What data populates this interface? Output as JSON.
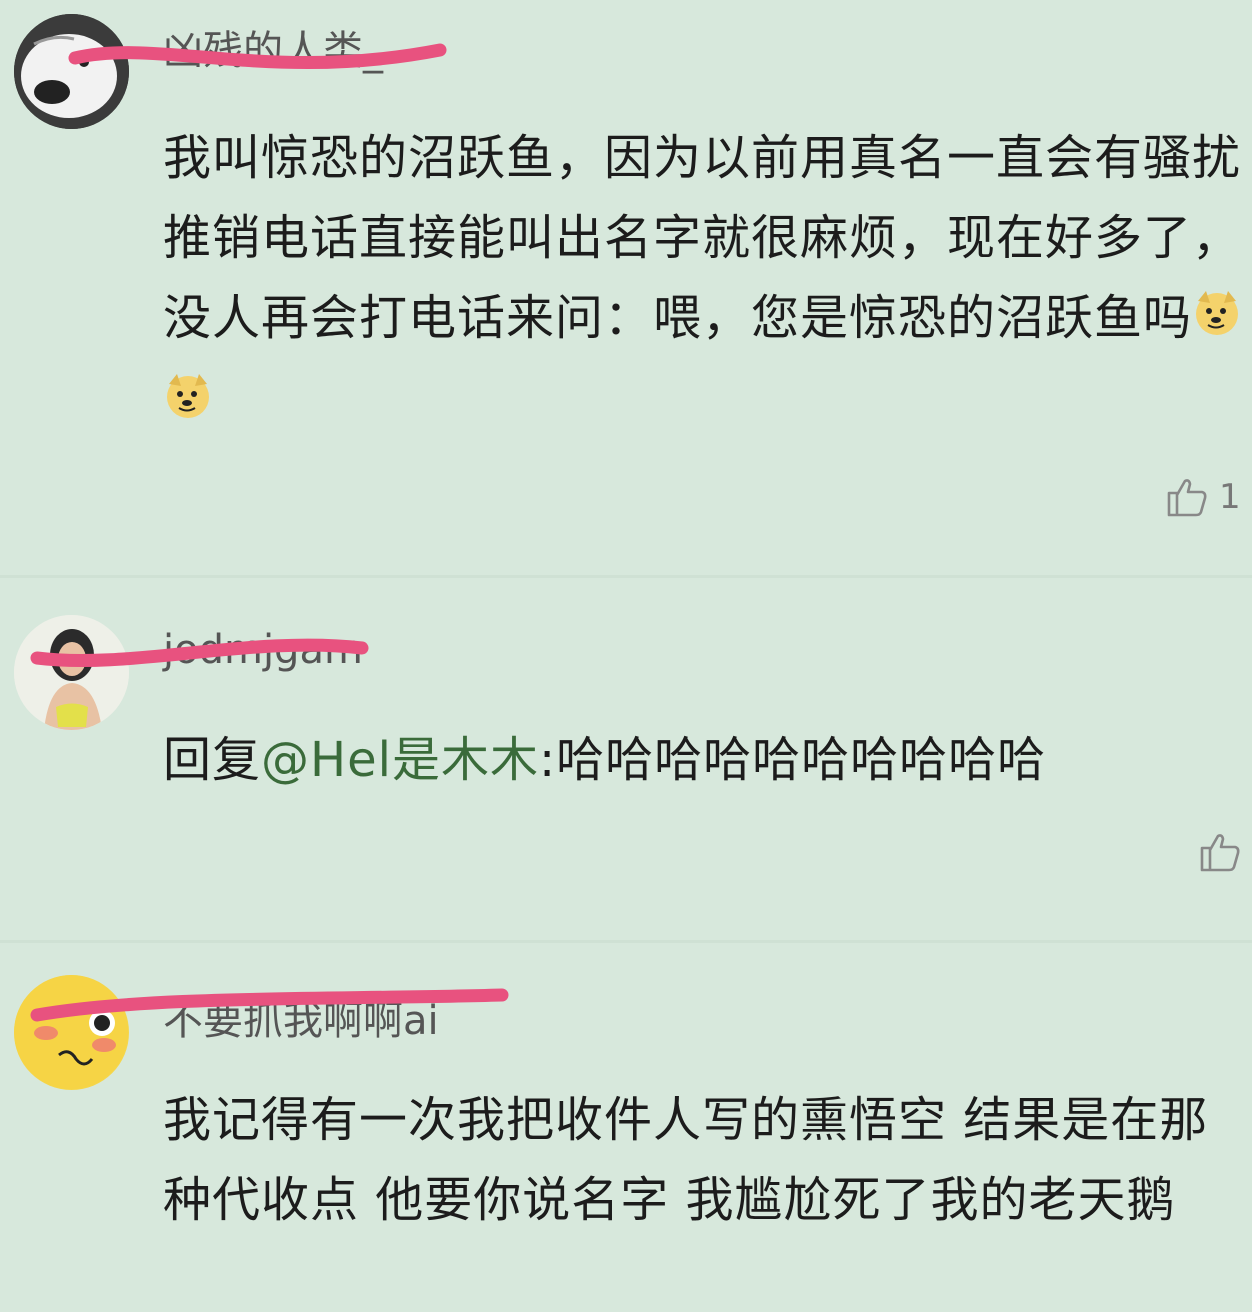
{
  "comments": [
    {
      "username": "凶残的人类_",
      "text": "我叫惊恐的沼跃鱼，因为以前用真名一直会有骚扰推销电话直接能叫出名字就很麻烦，现在好多了，没人再会打电话来问：喂，您是惊恐的沼跃鱼吗",
      "emoji": [
        "doge-emoji",
        "doge-emoji"
      ],
      "likes": "1"
    },
    {
      "username": "jodmjgam",
      "reply_prefix": "回复",
      "mention": "@Hel是木木",
      "reply_text": ":哈哈哈哈哈哈哈哈哈哈",
      "likes": ""
    },
    {
      "username": "不要抓我啊啊ai",
      "text": "我记得有一次我把收件人写的熏悟空 结果是在那种代收点 他要你说名字 我尴尬死了我的老天鹅"
    }
  ],
  "colors": {
    "background": "#d7e8dc",
    "scribble": "#e8527f",
    "mention": "#3a6b3a"
  }
}
